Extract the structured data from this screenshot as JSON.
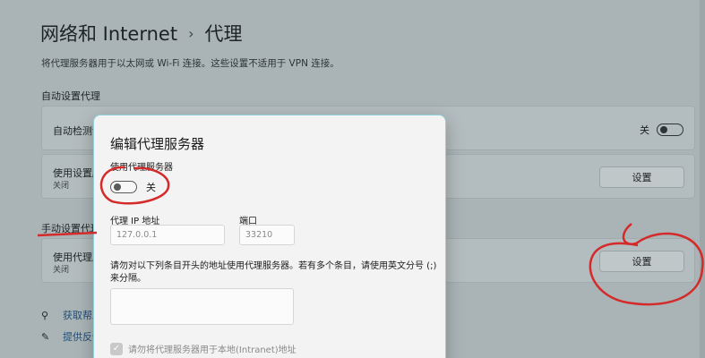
{
  "header": {
    "breadcrumb_parent": "网络和 Internet",
    "breadcrumb_sep": "›",
    "breadcrumb_current": "代理"
  },
  "description": "将代理服务器用于以太网或 Wi-Fi 连接。这些设置不适用于 VPN 连接。",
  "auto_section": {
    "title": "自动设置代理",
    "detect_label": "自动检测设",
    "detect_state": "关",
    "script_label": "使用设置脚",
    "script_state": "关闭",
    "script_button": "设置"
  },
  "manual_section": {
    "title": "手动设置代理",
    "proxy_label": "使用代理服",
    "proxy_state": "关闭",
    "proxy_button": "设置"
  },
  "links": [
    {
      "icon": "help-icon",
      "label": "获取帮助"
    },
    {
      "icon": "feedback-icon",
      "label": "提供反馈"
    }
  ],
  "dialog": {
    "title": "编辑代理服务器",
    "use_proxy_label": "使用代理服务器",
    "use_proxy_state": "关",
    "ip_label": "代理 IP 地址",
    "ip_placeholder": "127.0.0.1",
    "port_label": "端口",
    "port_placeholder": "33210",
    "exceptions_hint": "请勿对以下列条目开头的地址使用代理服务器。若有多个条目，请使用英文分号 (;) 来分隔。",
    "local_checkbox_label": "请勿将代理服务器用于本地(Intranet)地址",
    "local_checkbox_checked": true
  },
  "colors": {
    "annotation": "#d42a2a",
    "dialog_border": "#8fd2dc"
  }
}
